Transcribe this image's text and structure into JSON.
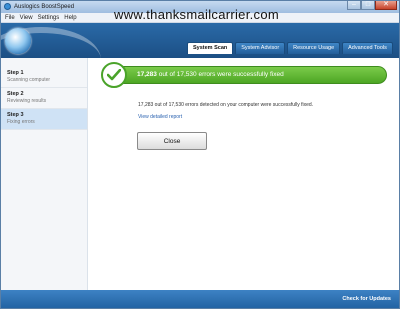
{
  "window": {
    "title": "Auslogics BoostSpeed",
    "controls": {
      "minimize": "–",
      "maximize": "□",
      "close": "✕"
    }
  },
  "menu": [
    "File",
    "View",
    "Settings",
    "Help"
  ],
  "watermark": "www.thanksmailcarrier.com",
  "tabs": [
    {
      "label": "System Scan",
      "active": true
    },
    {
      "label": "System Advisor",
      "active": false
    },
    {
      "label": "Resource Usage",
      "active": false
    },
    {
      "label": "Advanced Tools",
      "active": false
    }
  ],
  "steps": [
    {
      "title": "Step 1",
      "subtitle": "Scanning computer",
      "active": false
    },
    {
      "title": "Step 2",
      "subtitle": "Reviewing results",
      "active": false
    },
    {
      "title": "Step 3",
      "subtitle": "Fixing errors",
      "active": true
    }
  ],
  "result": {
    "fixed_count": "17,283",
    "summary_rest": "out of 17,530 errors were successfully fixed",
    "detail": "17,283 out of 17,530 errors detected on your computer were successfully fixed.",
    "report_link": "View detailed report",
    "close_label": "Close"
  },
  "footer": {
    "update_link": "Check for Updates"
  },
  "colors": {
    "accent": "#2363a3",
    "success": "#4da624",
    "link": "#2a62b0"
  }
}
